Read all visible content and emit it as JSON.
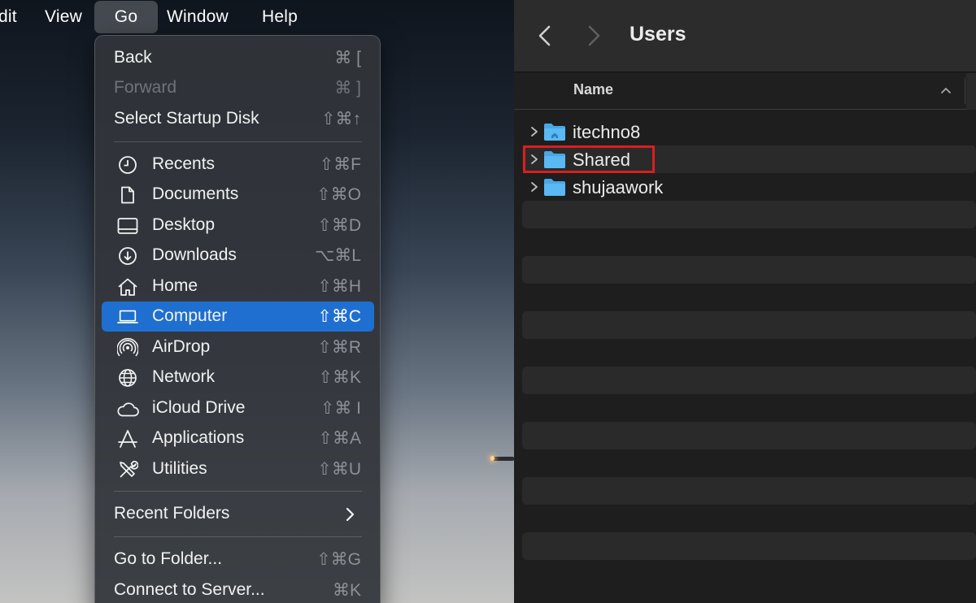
{
  "menubar": {
    "items": [
      "dit",
      "View",
      "Go",
      "Window",
      "Help"
    ]
  },
  "go_menu": {
    "nav_items": [
      {
        "label": "Back",
        "shortcut": "⌘ ["
      },
      {
        "label": "Forward",
        "shortcut": "⌘ ]"
      },
      {
        "label": "Select Startup Disk",
        "shortcut": "⇧⌘↑"
      }
    ],
    "place_items": [
      {
        "label": "Recents",
        "shortcut": "⇧⌘F",
        "icon": "clock-icon"
      },
      {
        "label": "Documents",
        "shortcut": "⇧⌘O",
        "icon": "document-icon"
      },
      {
        "label": "Desktop",
        "shortcut": "⇧⌘D",
        "icon": "desktop-icon"
      },
      {
        "label": "Downloads",
        "shortcut": "⌥⌘L",
        "icon": "download-icon"
      },
      {
        "label": "Home",
        "shortcut": "⇧⌘H",
        "icon": "home-icon"
      },
      {
        "label": "Computer",
        "shortcut": "⇧⌘C",
        "icon": "laptop-icon"
      },
      {
        "label": "AirDrop",
        "shortcut": "⇧⌘R",
        "icon": "airdrop-icon"
      },
      {
        "label": "Network",
        "shortcut": "⇧⌘K",
        "icon": "globe-icon"
      },
      {
        "label": "iCloud Drive",
        "shortcut": "⇧⌘ I",
        "icon": "cloud-icon"
      },
      {
        "label": "Applications",
        "shortcut": "⇧⌘A",
        "icon": "applications-icon"
      },
      {
        "label": "Utilities",
        "shortcut": "⇧⌘U",
        "icon": "tools-icon"
      }
    ],
    "recent_folders": {
      "label": "Recent Folders"
    },
    "bottom_items": [
      {
        "label": "Go to Folder...",
        "shortcut": "⇧⌘G"
      },
      {
        "label": "Connect to Server...",
        "shortcut": "⌘K"
      }
    ]
  },
  "finder": {
    "title": "Users",
    "column_header": "Name",
    "rows": [
      {
        "name": "itechno8"
      },
      {
        "name": "Shared"
      },
      {
        "name": "shujaawork"
      }
    ]
  },
  "colors": {
    "menu_highlight": "#1f6fd0",
    "annotation_box": "#d81f1f",
    "folder_blue": "#5ab8f2"
  }
}
